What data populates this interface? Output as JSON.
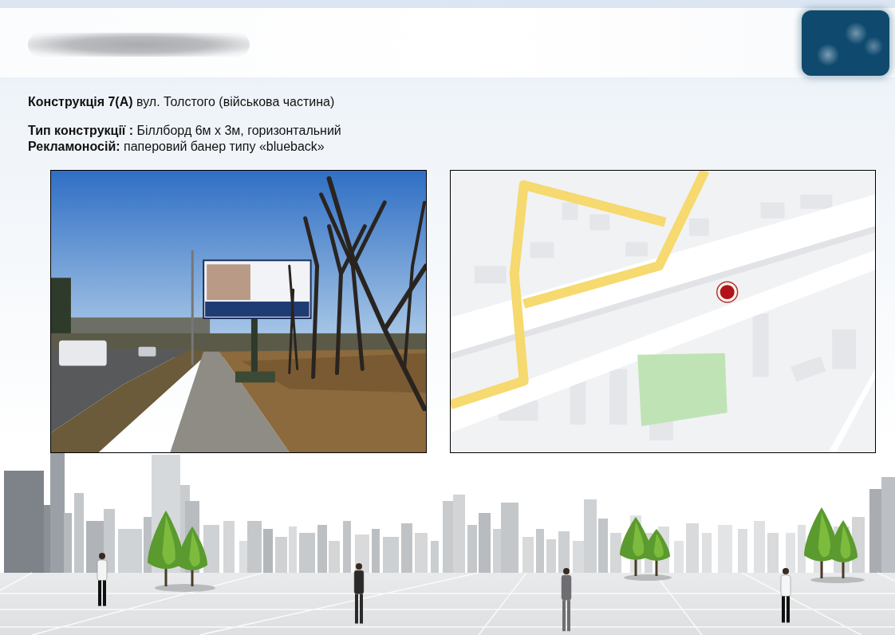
{
  "description": {
    "title": "**Конструкція 7(А)** вул. Толстого (військова частина)",
    "details": [
      "**Тип конструкції :** Біллборд 6м х 3м, горизонтальний",
      "**Рекламоносій:** паперовий банер типу «blueback»"
    ]
  }
}
